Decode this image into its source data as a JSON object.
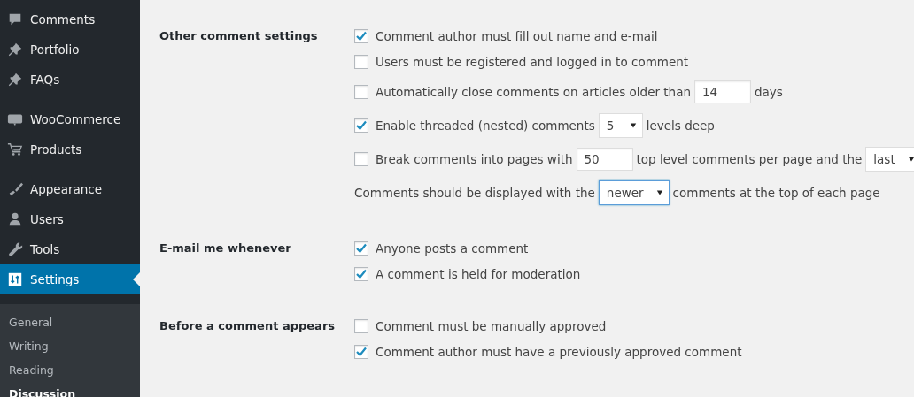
{
  "sidebar": {
    "groups": [
      [
        {
          "label": "Comments",
          "selected": false
        },
        {
          "label": "Portfolio",
          "selected": false
        },
        {
          "label": "FAQs",
          "selected": false
        }
      ],
      [
        {
          "label": "WooCommerce",
          "selected": false
        },
        {
          "label": "Products",
          "selected": false
        }
      ],
      [
        {
          "label": "Appearance",
          "selected": false
        },
        {
          "label": "Users",
          "selected": false
        },
        {
          "label": "Tools",
          "selected": false
        },
        {
          "label": "Settings",
          "selected": true
        }
      ]
    ],
    "submenu": [
      {
        "label": "General",
        "selected": false
      },
      {
        "label": "Writing",
        "selected": false
      },
      {
        "label": "Reading",
        "selected": false
      },
      {
        "label": "Discussion",
        "selected": true
      }
    ]
  },
  "sections": [
    {
      "label": "Other comment settings",
      "options": [
        {
          "kind": "checkbox",
          "checked": true,
          "parts": [
            {
              "kind": "text",
              "text": "Comment author must fill out name and e-mail"
            }
          ]
        },
        {
          "kind": "checkbox",
          "checked": false,
          "parts": [
            {
              "kind": "text",
              "text": "Users must be registered and logged in to comment"
            }
          ]
        },
        {
          "kind": "checkbox",
          "checked": false,
          "parts": [
            {
              "kind": "text",
              "text": "Automatically close comments on articles older than"
            },
            {
              "kind": "input",
              "value": "14"
            },
            {
              "kind": "text",
              "text": "days"
            }
          ]
        },
        {
          "kind": "checkbox",
          "checked": true,
          "parts": [
            {
              "kind": "text",
              "text": "Enable threaded (nested) comments"
            },
            {
              "kind": "select",
              "value": "5"
            },
            {
              "kind": "text",
              "text": "levels deep"
            }
          ]
        },
        {
          "kind": "checkbox",
          "checked": false,
          "parts": [
            {
              "kind": "text",
              "text": "Break comments into pages with"
            },
            {
              "kind": "input",
              "value": "50"
            },
            {
              "kind": "text",
              "text": "top level comments per page and the"
            },
            {
              "kind": "select",
              "value": "last"
            }
          ]
        },
        {
          "kind": "plain",
          "parts": [
            {
              "kind": "text",
              "text": "Comments should be displayed with the"
            },
            {
              "kind": "select",
              "value": "newer",
              "focused": true
            },
            {
              "kind": "text",
              "text": "comments at the top of each page"
            }
          ]
        }
      ]
    },
    {
      "label": "E-mail me whenever",
      "options": [
        {
          "kind": "checkbox",
          "checked": true,
          "parts": [
            {
              "kind": "text",
              "text": "Anyone posts a comment"
            }
          ]
        },
        {
          "kind": "checkbox",
          "checked": true,
          "parts": [
            {
              "kind": "text",
              "text": "A comment is held for moderation"
            }
          ]
        }
      ]
    },
    {
      "label": "Before a comment appears",
      "options": [
        {
          "kind": "checkbox",
          "checked": false,
          "parts": [
            {
              "kind": "text",
              "text": "Comment must be manually approved"
            }
          ]
        },
        {
          "kind": "checkbox",
          "checked": true,
          "parts": [
            {
              "kind": "text",
              "text": "Comment author must have a previously approved comment"
            }
          ]
        }
      ]
    }
  ]
}
